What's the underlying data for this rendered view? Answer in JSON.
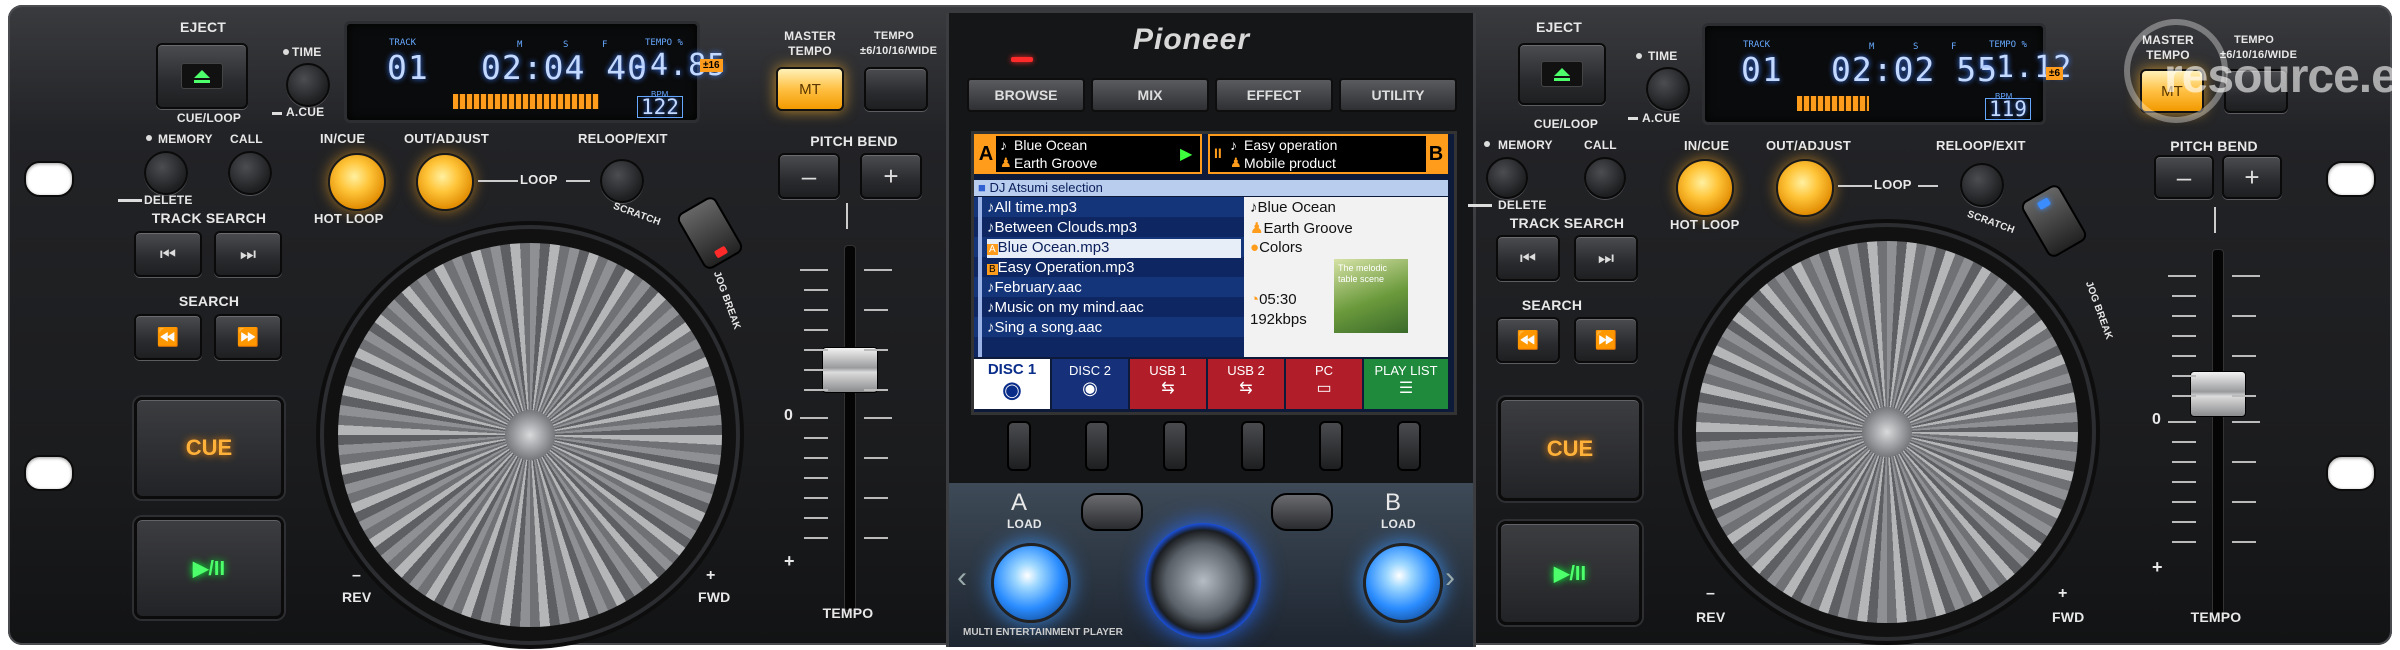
{
  "deck_a": {
    "eject": "EJECT",
    "time": "TIME",
    "a_cue": "A.CUE",
    "cue_loop": "CUE/LOOP",
    "memory": "MEMORY",
    "call": "CALL",
    "delete": "DELETE",
    "track_search": "TRACK SEARCH",
    "search": "SEARCH",
    "cue": "CUE",
    "play_pause": "▶/II",
    "in_cue": "IN/CUE",
    "out_adjust": "OUT/ADJUST",
    "loop": "LOOP",
    "reloop_exit": "RELOOP/EXIT",
    "hot_loop": "HOT LOOP",
    "scratch": "SCRATCH",
    "jog_break": "JOG BREAK",
    "rev": "REV",
    "fwd": "FWD",
    "master_tempo_label": "MASTER TEMPO",
    "master_tempo_btn": "MT",
    "tempo_range": "TEMPO ±6/10/16/WIDE",
    "pitch_bend": "PITCH BEND",
    "tempo": "TEMPO",
    "plus": "+",
    "minus": "–",
    "zero": "0",
    "display": {
      "track_label": "TRACK",
      "track": "01",
      "m_label": "M",
      "s_label": "S",
      "f_label": "F",
      "time": "02:04 40",
      "tempo_label": "TEMPO %",
      "tempo_value": "-4.85",
      "range_badge": "±16",
      "bpm_label": "BPM",
      "bpm": "122"
    }
  },
  "deck_b": {
    "eject": "EJECT",
    "time": "TIME",
    "a_cue": "A.CUE",
    "cue_loop": "CUE/LOOP",
    "memory": "MEMORY",
    "call": "CALL",
    "delete": "DELETE",
    "track_search": "TRACK SEARCH",
    "search": "SEARCH",
    "cue": "CUE",
    "play_pause": "▶/II",
    "in_cue": "IN/CUE",
    "out_adjust": "OUT/ADJUST",
    "loop": "LOOP",
    "reloop_exit": "RELOOP/EXIT",
    "hot_loop": "HOT LOOP",
    "scratch": "SCRATCH",
    "jog_break": "JOG BREAK",
    "rev": "REV",
    "fwd": "FWD",
    "master_tempo_label": "MASTER TEMPO",
    "master_tempo_btn": "MT",
    "tempo_range": "TEMPO ±6/10/16/WIDE",
    "pitch_bend": "PITCH BEND",
    "tempo": "TEMPO",
    "plus": "+",
    "minus": "–",
    "zero": "0",
    "display": {
      "track_label": "TRACK",
      "track": "01",
      "m_label": "M",
      "s_label": "S",
      "f_label": "F",
      "time": "02:02 55",
      "tempo_label": "TEMPO %",
      "tempo_value": "-1.12",
      "range_badge": "±6",
      "bpm_label": "BPM",
      "bpm": "119"
    }
  },
  "center": {
    "brand": "Pioneer",
    "tabs": [
      "BROWSE",
      "MIX",
      "EFFECT",
      "UTILITY"
    ],
    "deck_a_letter": "A",
    "deck_b_letter": "B",
    "deck_a_title": "Blue Ocean",
    "deck_a_artist": "Earth Groove",
    "deck_b_title": "Easy operation",
    "deck_b_artist": "Mobile product",
    "folder": "DJ Atsumi selection",
    "files": [
      "All time.mp3",
      "Between Clouds.mp3",
      "Blue Ocean.mp3",
      "Easy Operation.mp3",
      "February.aac",
      "Music on my mind.aac",
      "Sing a song.aac"
    ],
    "info_title": "Blue Ocean",
    "info_artist": "Earth Groove",
    "info_genre": "Colors",
    "info_time": "05:30",
    "info_bitrate": "192kbps",
    "album_art_text": "The melodic table scene",
    "sources": [
      "DISC 1",
      "DISC 2",
      "USB 1",
      "USB 2",
      "PC",
      "PLAY LIST"
    ],
    "load_a_letter": "A",
    "load_b_letter": "B",
    "load": "LOAD",
    "footer": "MULTI ENTERTAINMENT PLAYER"
  },
  "watermark": "resource.eu",
  "colors": {
    "accent_orange": "#ffb52a",
    "lcd_blue": "#c4d9ff",
    "load_blue": "#2a8cff",
    "cue_text": "#ffb13a",
    "play_text": "#4dff6b"
  }
}
